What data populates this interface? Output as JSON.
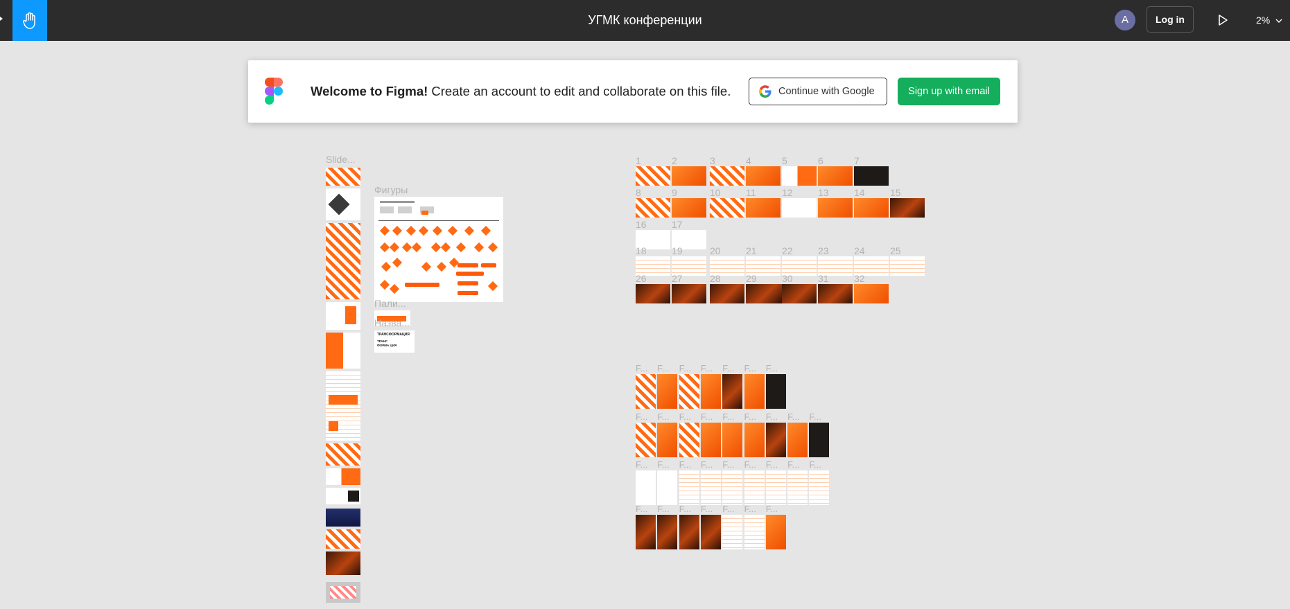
{
  "toolbar": {
    "tool": "hand-icon",
    "title": "УГМК конференции",
    "avatar_initial": "A",
    "login_label": "Log in",
    "play": "play-icon",
    "zoom_label": "2%"
  },
  "banner": {
    "welcome_bold": "Welcome to Figma!",
    "welcome_text": " Create an account to edit and collaborate on this file.",
    "google_label": "Continue with Google",
    "email_label": "Sign up with email"
  },
  "canvas": {
    "sections": {
      "slides": "Slide...",
      "figures": "Фигуры",
      "palette": "Пали...",
      "names": "Назва..."
    },
    "slide_numbers": [
      "1",
      "2",
      "3",
      "4",
      "5",
      "6",
      "7",
      "8",
      "9",
      "10",
      "11",
      "12",
      "13",
      "14",
      "15",
      "16",
      "17",
      "18",
      "19",
      "20",
      "21",
      "22",
      "23",
      "24",
      "25",
      "26",
      "27",
      "28",
      "29",
      "30",
      "31",
      "32"
    ],
    "frame_label": "F...",
    "names_text_1": "ТРАНСФОРМАЦИЯ",
    "names_text_2": "ТРАНС ФОРМА ЦИЯ"
  },
  "colors": {
    "accent": "#ff6a13",
    "toolbar_bg": "#2c2c2c",
    "tool_active": "#0d99ff",
    "signup_green": "#14ae5c",
    "canvas_bg": "#e5e5e5"
  }
}
